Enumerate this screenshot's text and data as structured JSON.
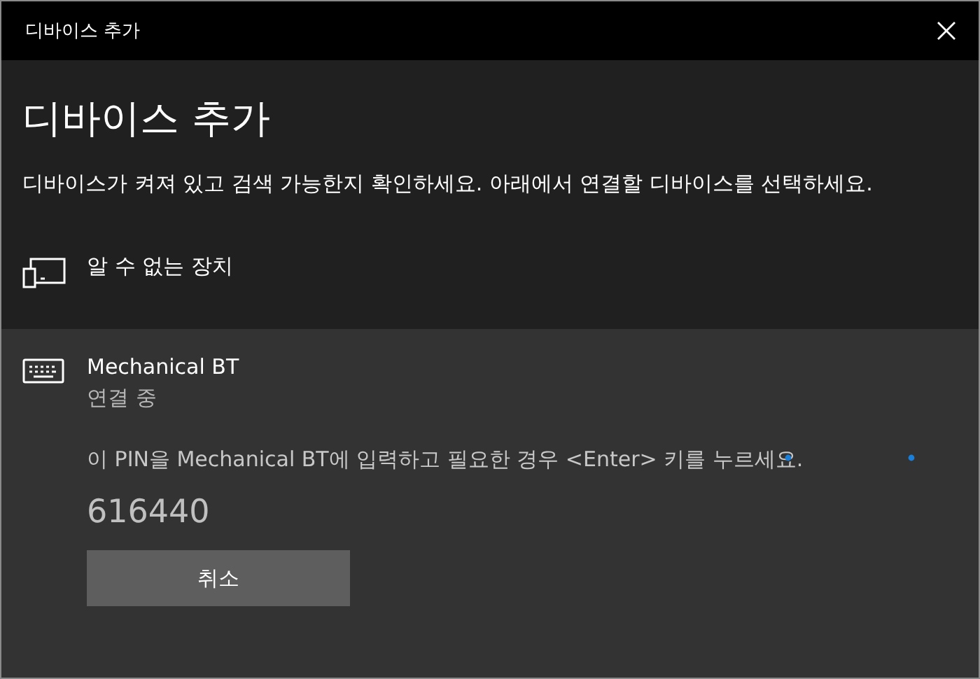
{
  "window": {
    "title": "디바이스 추가"
  },
  "heading": "디바이스 추가",
  "description": "디바이스가 켜져 있고 검색 가능한지 확인하세요. 아래에서 연결할 디바이스를 선택하세요.",
  "devices": [
    {
      "kind": "unknown",
      "name": "알 수 없는 장치",
      "selected": false
    },
    {
      "kind": "keyboard",
      "name": "Mechanical BT",
      "selected": true,
      "status": "연결 중",
      "instruction": "이 PIN을 Mechanical BT에 입력하고 필요한 경우 <Enter> 키를 누르세요.",
      "pin": "616440",
      "button": "취소"
    }
  ]
}
